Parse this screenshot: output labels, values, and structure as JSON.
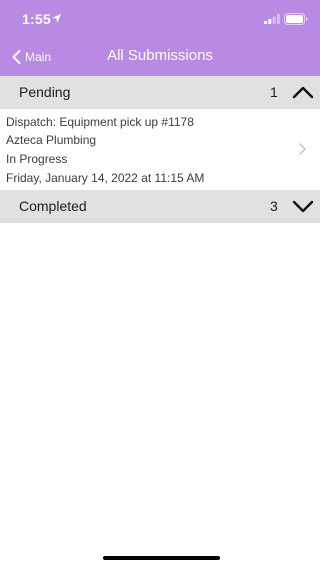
{
  "status_bar": {
    "time": "1:55"
  },
  "nav": {
    "back_label": "Main",
    "title": "All Submissions"
  },
  "sections": [
    {
      "title": "Pending",
      "count": "1",
      "expanded": true
    },
    {
      "title": "Completed",
      "count": "3",
      "expanded": false
    }
  ],
  "pending_items": [
    {
      "dispatch": "Dispatch: Equipment pick up #1178",
      "company": "Azteca Plumbing",
      "status": "In Progress",
      "date": "Friday, January 14, 2022 at 11:15 AM"
    }
  ],
  "colors": {
    "header": "#b88ae4",
    "section_bg": "#e1e1e1"
  },
  "icons": [
    "location-arrow-icon",
    "signal-icon",
    "battery-icon",
    "chevron-left-icon",
    "chevron-up-icon",
    "chevron-down-icon",
    "chevron-right-icon"
  ]
}
